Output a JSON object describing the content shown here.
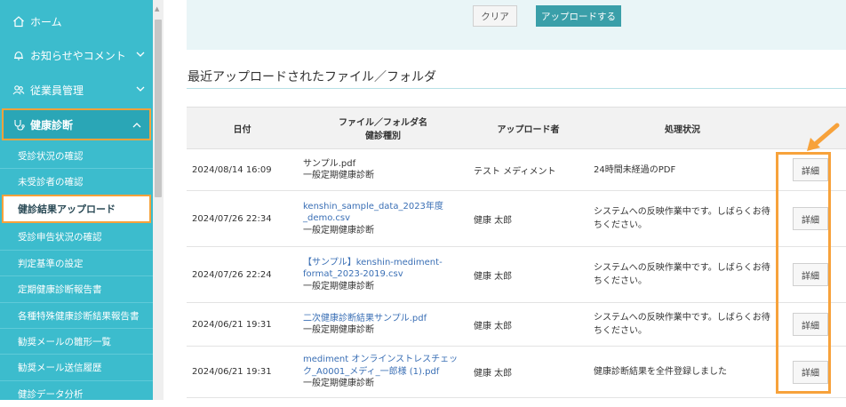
{
  "sidebar": {
    "top_items": [
      {
        "label": "ホーム",
        "icon": "home-icon"
      },
      {
        "label": "お知らせやコメント",
        "icon": "bell-icon"
      },
      {
        "label": "従業員管理",
        "icon": "users-icon"
      }
    ],
    "active_section": {
      "label": "健康診断",
      "icon": "stethoscope-icon"
    },
    "sub_items": [
      "受診状況の確認",
      "未受診者の確認",
      "健診結果アップロード",
      "受診申告状況の確認",
      "判定基準の設定",
      "定期健康診断報告書",
      "各種特殊健康診断結果報告書",
      "勧奨メールの雛形一覧",
      "勧奨メール送信履歴",
      "健診データ分析"
    ]
  },
  "toolbar": {
    "clear_label": "クリア",
    "upload_label": "アップロードする"
  },
  "main": {
    "section_title": "最近アップロードされたファイル／フォルダ",
    "table": {
      "headers": {
        "date": "日付",
        "file_line1": "ファイル／フォルダ名",
        "file_line2": "健診種別",
        "uploader": "アップロード者",
        "status": "処理状況"
      },
      "rows": [
        {
          "date": "2024/08/14 16:09",
          "file": "サンプル.pdf",
          "type": "一般定期健康診断",
          "uploader": "テスト メディメント",
          "status": "24時間未経過のPDF",
          "detail": "詳細"
        },
        {
          "date": "2024/07/26 22:34",
          "file": "kenshin_sample_data_2023年度_demo.csv",
          "type": "一般定期健康診断",
          "uploader": "健康 太郎",
          "status": "システムへの反映作業中です。しばらくお待ちください。",
          "detail": "詳細"
        },
        {
          "date": "2024/07/26 22:24",
          "file": "【サンプル】kenshin-mediment-format_2023-2019.csv",
          "type": "一般定期健康診断",
          "uploader": "健康 太郎",
          "status": "システムへの反映作業中です。しばらくお待ちください。",
          "detail": "詳細"
        },
        {
          "date": "2024/06/21 19:31",
          "file": "二次健康診断結果サンプル.pdf",
          "type": "一般定期健康診断",
          "uploader": "健康 太郎",
          "status": "システムへの反映作業中です。しばらくお待ちください。",
          "detail": "詳細"
        },
        {
          "date": "2024/06/21 19:31",
          "file": "mediment オンラインストレスチェック_A0001_メディ_一郎様 (1).pdf",
          "type": "一般定期健康診断",
          "uploader": "健康 太郎",
          "status": "健康診断結果を全件登録しました",
          "detail": "詳細"
        }
      ]
    }
  },
  "colors": {
    "sidebar": "#3cbccd",
    "accent": "#3a9fa9",
    "highlight": "#f7a23b",
    "link": "#3a6fb5"
  }
}
